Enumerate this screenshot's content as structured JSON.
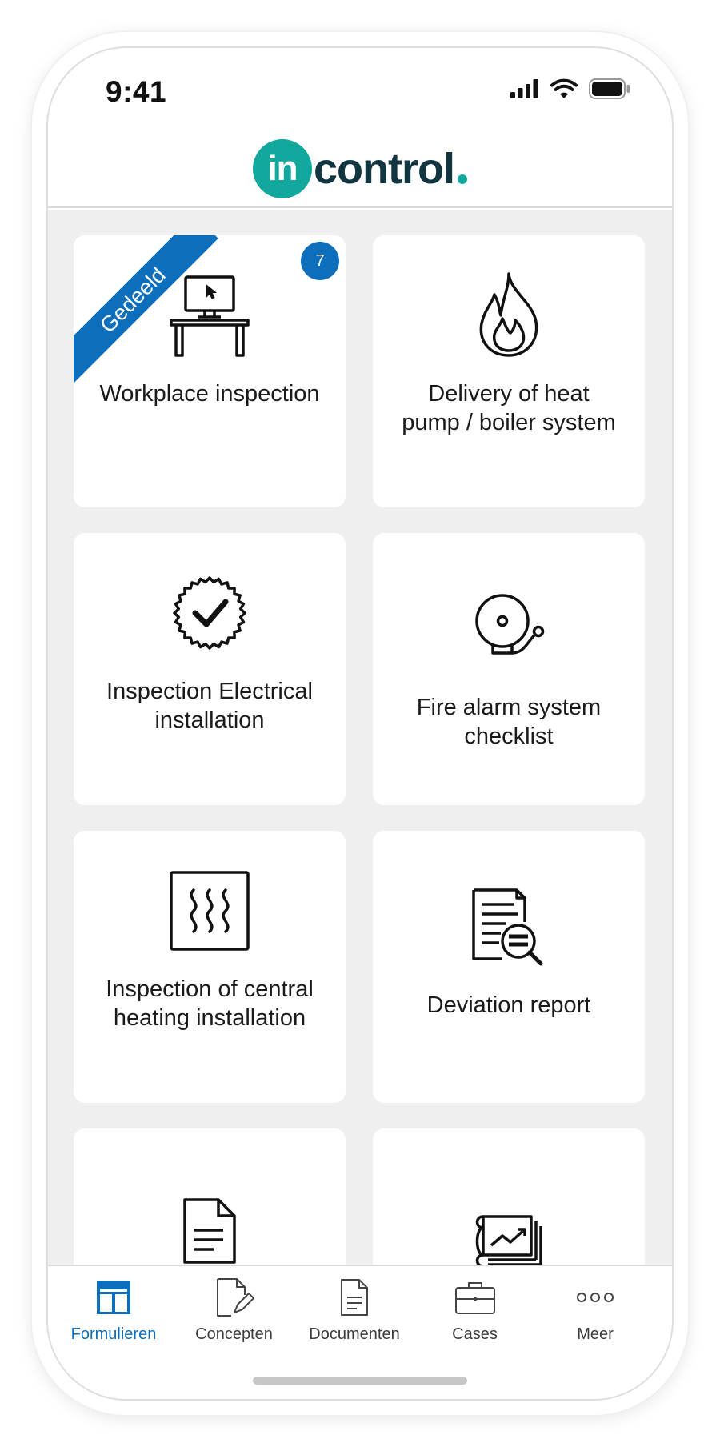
{
  "status": {
    "time": "9:41"
  },
  "brand": {
    "badge": "in",
    "word": "control",
    "color_primary": "#13a89e",
    "color_text": "#113640"
  },
  "accent": "#0d6ebc",
  "cards": [
    {
      "title": "Workplace inspection",
      "icon": "desk-computer-icon",
      "ribbon": "Gedeeld",
      "badge": "7"
    },
    {
      "title": "Delivery of heat pump / boiler system",
      "icon": "flame-icon"
    },
    {
      "title": "Inspection Electrical installation",
      "icon": "certified-check-icon"
    },
    {
      "title": "Fire alarm system checklist",
      "icon": "alarm-bell-icon"
    },
    {
      "title": "Inspection of central heating installation",
      "icon": "heater-icon"
    },
    {
      "title": "Deviation report",
      "icon": "document-search-icon"
    },
    {
      "title": "",
      "icon": "document-icon"
    },
    {
      "title": "",
      "icon": "report-chart-icon"
    }
  ],
  "tabs": [
    {
      "label": "Formulieren",
      "icon": "forms-icon",
      "active": true
    },
    {
      "label": "Concepten",
      "icon": "draft-edit-icon"
    },
    {
      "label": "Documenten",
      "icon": "document-icon"
    },
    {
      "label": "Cases",
      "icon": "briefcase-icon"
    },
    {
      "label": "Meer",
      "icon": "more-icon"
    }
  ]
}
